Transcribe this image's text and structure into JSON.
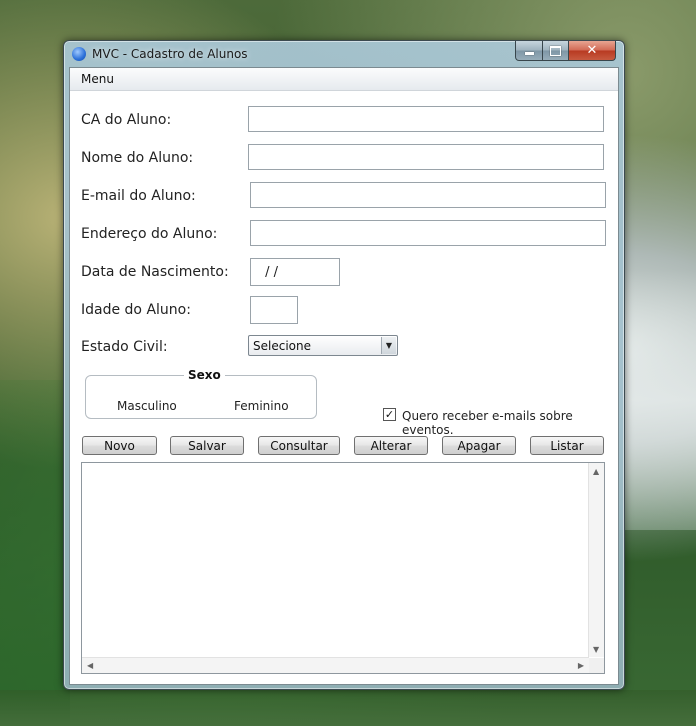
{
  "window": {
    "title": "MVC - Cadastro de Alunos",
    "app_icon": "java-app-icon",
    "controls": {
      "minimize": "minimize-icon",
      "maximize": "maximize-icon",
      "close": "close-icon",
      "close_glyph": "✕"
    }
  },
  "menubar": {
    "menu_label": "Menu"
  },
  "form": {
    "ca_label": "CA do Aluno:",
    "ca_value": "",
    "nome_label": "Nome do Aluno:",
    "nome_value": "",
    "email_label": "E-mail do Aluno:",
    "email_value": "",
    "endereco_label": "Endereço do Aluno:",
    "endereco_value": "",
    "nascimento_label": "Data de Nascimento:",
    "nascimento_value": " / /",
    "idade_label": "Idade do Aluno:",
    "idade_value": "",
    "estado_civil_label": "Estado Civil:",
    "estado_civil_selected": "Selecione"
  },
  "sexo": {
    "legend": "Sexo",
    "option_masculino": "Masculino",
    "option_feminino": "Feminino"
  },
  "newsletter": {
    "label": "Quero receber e-mails sobre eventos.",
    "checked": true,
    "check_glyph": "✓"
  },
  "buttons": {
    "novo": "Novo",
    "salvar": "Salvar",
    "consultar": "Consultar",
    "alterar": "Alterar",
    "apagar": "Apagar",
    "listar": "Listar"
  },
  "output": {
    "text": ""
  },
  "colors": {
    "close_button": "#c7402a",
    "window_frame": "#9fb8c4"
  }
}
